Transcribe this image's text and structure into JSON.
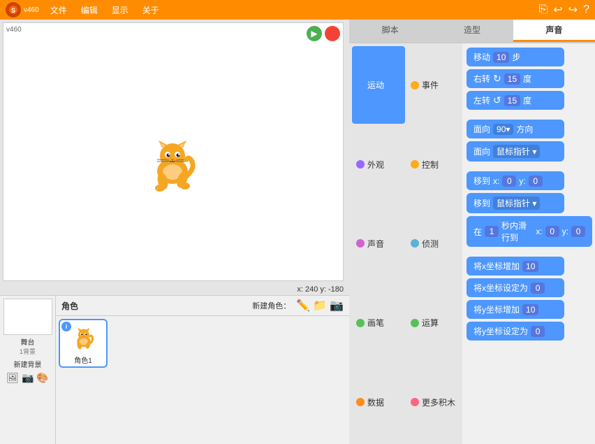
{
  "app": {
    "version": "v460",
    "logo_text": "Scratch"
  },
  "menubar": {
    "items": [
      "文件",
      "编辑",
      "显示",
      "关于"
    ]
  },
  "tabs": [
    {
      "id": "scripts",
      "label": "脚本"
    },
    {
      "id": "costumes",
      "label": "造型"
    },
    {
      "id": "sounds",
      "label": "声音"
    }
  ],
  "active_tab": "sounds",
  "categories": [
    {
      "id": "motion",
      "label": "运动",
      "color": "#4d97ff",
      "active": true
    },
    {
      "id": "events",
      "label": "事件",
      "color": "#ffab19"
    },
    {
      "id": "appearance",
      "label": "外观",
      "color": "#9966ff"
    },
    {
      "id": "control",
      "label": "控制",
      "color": "#ffab19"
    },
    {
      "id": "sound",
      "label": "声音",
      "color": "#cf63cf"
    },
    {
      "id": "sensing",
      "label": "侦测",
      "color": "#5cb1d6"
    },
    {
      "id": "pen",
      "label": "画笔",
      "color": "#59c059"
    },
    {
      "id": "operators",
      "label": "运算",
      "color": "#59c059"
    },
    {
      "id": "data",
      "label": "数据",
      "color": "#ff8c1a"
    },
    {
      "id": "more",
      "label": "更多积木",
      "color": "#ff6680"
    }
  ],
  "blocks": [
    {
      "id": "move",
      "type": "motion",
      "text_parts": [
        "移动",
        "10",
        "步"
      ]
    },
    {
      "id": "turn_right",
      "type": "motion",
      "text_parts": [
        "右转",
        "↻",
        "15",
        "度"
      ]
    },
    {
      "id": "turn_left",
      "type": "motion",
      "text_parts": [
        "左转",
        "↺",
        "15",
        "度"
      ]
    },
    {
      "id": "gap1",
      "type": "gap"
    },
    {
      "id": "face_dir",
      "type": "motion",
      "text_parts": [
        "面向",
        "90▾",
        "方向"
      ]
    },
    {
      "id": "face_mouse",
      "type": "motion",
      "text_parts": [
        "面向",
        "鼠标指针 ▾"
      ]
    },
    {
      "id": "gap2",
      "type": "gap"
    },
    {
      "id": "goto_xy",
      "type": "motion",
      "text_parts": [
        "移到",
        "x:",
        "0",
        "y:",
        "0"
      ]
    },
    {
      "id": "goto_mouse",
      "type": "motion",
      "text_parts": [
        "移到",
        "鼠标指针 ▾"
      ]
    },
    {
      "id": "glide",
      "type": "motion",
      "text_parts": [
        "在",
        "1",
        "秒内滑行到",
        "x:",
        "0",
        "y:",
        "0"
      ]
    },
    {
      "id": "gap3",
      "type": "gap"
    },
    {
      "id": "change_x",
      "type": "motion",
      "text_parts": [
        "将x坐标增加",
        "10"
      ]
    },
    {
      "id": "set_x",
      "type": "motion",
      "text_parts": [
        "将x坐标设定为",
        "0"
      ]
    },
    {
      "id": "change_y",
      "type": "motion",
      "text_parts": [
        "将y坐标增加",
        "10"
      ]
    },
    {
      "id": "set_y",
      "type": "motion",
      "text_parts": [
        "将y坐标设定为",
        "0"
      ]
    }
  ],
  "stage": {
    "version": "v460",
    "bg_label": "舞台",
    "bg_count": "1背景",
    "new_bg_label": "新建背景"
  },
  "sprites": {
    "title": "角色",
    "new_sprite_label": "新建角色：",
    "list": [
      {
        "id": "cat1",
        "name": "角色1",
        "selected": true
      }
    ]
  },
  "coordinates": {
    "label": "x: 240  y: -180"
  },
  "controls": {
    "green_flag_title": "点击绿旗",
    "stop_title": "停止"
  }
}
